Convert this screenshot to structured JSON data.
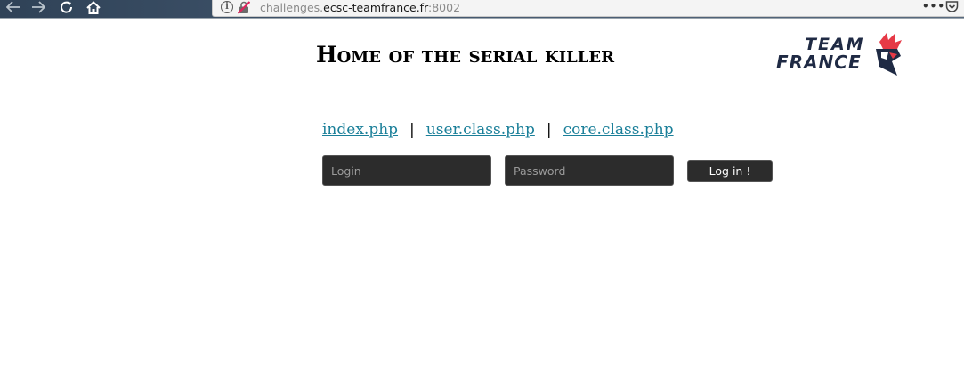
{
  "browser": {
    "url_prefix": "challenges.",
    "url_domain": "ecsc-teamfrance.fr",
    "url_suffix": ":8002",
    "info_icon_glyph": "i",
    "menu_glyph": "•••",
    "icons": [
      "back-icon",
      "forward-icon",
      "reload-icon",
      "home-icon",
      "info-icon",
      "insecure-connection-icon",
      "page-actions-icon",
      "pocket-icon"
    ]
  },
  "page": {
    "title": "Home of the serial killer",
    "logo": {
      "line1": "TEAM",
      "line2": "FRANCE",
      "colors": {
        "navy": "#1f2a44",
        "red": "#e63946"
      }
    },
    "links": [
      {
        "label": "index.php"
      },
      {
        "label": "user.class.php"
      },
      {
        "label": "core.class.php"
      }
    ],
    "separator": "|",
    "form": {
      "login_placeholder": "Login",
      "password_placeholder": "Password",
      "submit_label": "Log in !"
    },
    "colors": {
      "link": "#1a7f99",
      "field_bg": "#2c2c2c"
    }
  }
}
